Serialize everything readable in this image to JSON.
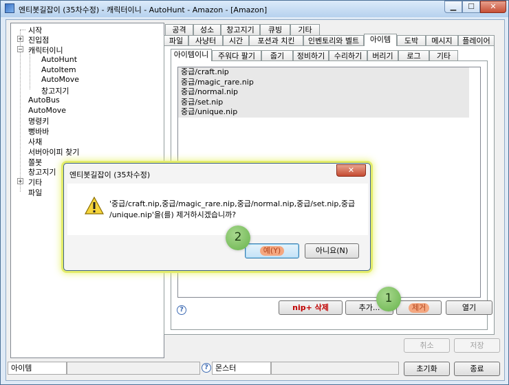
{
  "window": {
    "title": "엔티봇길잡이 (35차수정) - 캐릭터이니 - AutoHunt - Amazon - [Amazon]"
  },
  "tree": {
    "items": [
      {
        "label": "시작"
      },
      {
        "label": "진입점"
      },
      {
        "label": "캐릭터이니"
      },
      {
        "label": "AutoHunt"
      },
      {
        "label": "AutoItem"
      },
      {
        "label": "AutoMove"
      },
      {
        "label": "창고지기"
      },
      {
        "label": "AutoBus"
      },
      {
        "label": "AutoMove"
      },
      {
        "label": "명령키"
      },
      {
        "label": "뻥바바"
      },
      {
        "label": "사채"
      },
      {
        "label": "서버아이피 찾기"
      },
      {
        "label": "쫄봇"
      },
      {
        "label": "창고지기"
      },
      {
        "label": "기타"
      },
      {
        "label": "파일"
      }
    ]
  },
  "tabs_row1": [
    "공격",
    "성소",
    "창고지기",
    "큐빙",
    "기타"
  ],
  "tabs_row2": [
    "파일",
    "사냥터",
    "시간",
    "포션과 치킨",
    "인벤토리와 벨트",
    "아이템",
    "도박",
    "메시지",
    "플레이어"
  ],
  "subtabs": [
    "아이템이니",
    "주워다 팔기",
    "줍기",
    "정비하기",
    "수리하기",
    "버리기",
    "로그",
    "기타"
  ],
  "list": {
    "items": [
      "중급/craft.nip",
      "중급/magic_rare.nip",
      "중급/normal.nip",
      "중급/set.nip",
      "중급/unique.nip"
    ]
  },
  "buttons": {
    "nip_delete": "nip+ 삭제",
    "add": "추가...",
    "remove": "제거",
    "open": "열기",
    "cancel": "취소",
    "save": "저장",
    "reset": "초기화",
    "exit": "종료"
  },
  "status": {
    "item_label": "아이템",
    "monster_label": "몬스터"
  },
  "dialog": {
    "title": "엔티봇길잡이 (35차수정)",
    "message_line1": "'중급/craft.nip,중급/magic_rare.nip,중급/normal.nip,중급/set.nip,중급",
    "message_line2": "/unique.nip'을(를) 제거하시겠습니까?",
    "yes": "예(Y)",
    "no": "아니요(N)"
  },
  "steps": {
    "step1": "1",
    "step2": "2"
  },
  "colors": {
    "highlight_oval": "#f4a780",
    "step_badge": "#7cc05e",
    "dialog_glow": "#e3ec6a"
  }
}
